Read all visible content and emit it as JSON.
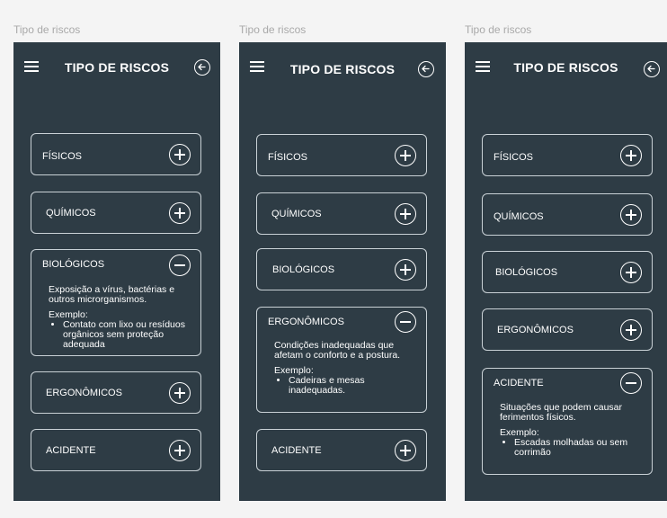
{
  "frames": [
    {
      "label": "Tipo de riscos",
      "title": "TIPO DE RISCOS",
      "items": [
        {
          "label": "FÍSICOS",
          "state": "collapsed"
        },
        {
          "label": "QUÍMICOS",
          "state": "collapsed"
        },
        {
          "label": "BIOLÓGICOS",
          "state": "expanded",
          "description": "Exposição a vírus, bactérias e outros microrganismos.",
          "example_label": "Exemplo:",
          "example": "Contato com lixo ou resíduos orgânicos sem proteção adequada"
        },
        {
          "label": "ERGONÔMICOS",
          "state": "collapsed"
        },
        {
          "label": "ACIDENTE",
          "state": "collapsed"
        }
      ]
    },
    {
      "label": "Tipo de riscos",
      "title": "TIPO DE RISCOS",
      "items": [
        {
          "label": "FÍSICOS",
          "state": "collapsed"
        },
        {
          "label": "QUÍMICOS",
          "state": "collapsed"
        },
        {
          "label": "BIOLÓGICOS",
          "state": "collapsed"
        },
        {
          "label": "ERGONÔMICOS",
          "state": "expanded",
          "description": "Condições inadequadas que afetam o conforto e a postura.",
          "example_label": "Exemplo:",
          "example": "Cadeiras e mesas inadequadas."
        },
        {
          "label": "ACIDENTE",
          "state": "collapsed"
        }
      ]
    },
    {
      "label": "Tipo de riscos",
      "title": "TIPO DE RISCOS",
      "items": [
        {
          "label": "FÍSICOS",
          "state": "collapsed"
        },
        {
          "label": "QUÍMICOS",
          "state": "collapsed"
        },
        {
          "label": "BIOLÓGICOS",
          "state": "collapsed"
        },
        {
          "label": "ERGONÔMICOS",
          "state": "collapsed"
        },
        {
          "label": "ACIDENTE",
          "state": "expanded",
          "description": "Situações que podem causar ferimentos físicos.",
          "example_label": "Exemplo:",
          "example": "Escadas molhadas ou sem corrimão"
        }
      ]
    }
  ],
  "colors": {
    "page_bg": "#f4f4f4",
    "phone_bg": "#2e3c45",
    "card_border": "#c9d1d6",
    "text": "#ffffff",
    "frame_label": "#a9a9a9"
  },
  "icons": {
    "menu": "hamburger-icon",
    "back": "arrow-left-circle-icon",
    "expand": "plus-circle-icon",
    "collapse": "minus-circle-icon"
  }
}
